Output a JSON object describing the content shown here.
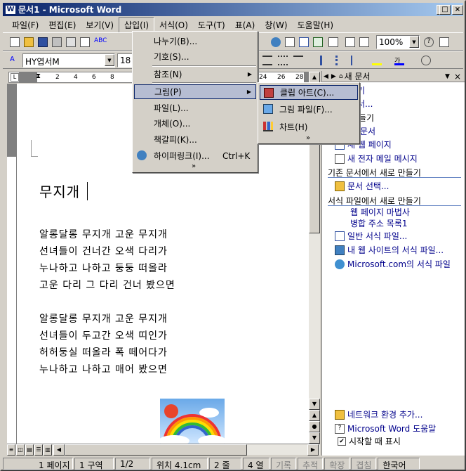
{
  "window": {
    "title": "문서1 - Microsoft Word",
    "icon": "word-doc-icon"
  },
  "menubar": [
    "파일(F)",
    "편집(E)",
    "보기(V)",
    "삽입(I)",
    "서식(O)",
    "도구(T)",
    "표(A)",
    "창(W)",
    "도움말(H)"
  ],
  "formatting": {
    "font": "HY엽서M",
    "size": "18",
    "zoom": "100%"
  },
  "ruler": [
    "2",
    "4",
    "6",
    "8",
    "24",
    "26",
    "28"
  ],
  "insert_menu": {
    "items": [
      {
        "label": "나누기(B)...",
        "icon": ""
      },
      {
        "label": "기호(S)...",
        "icon": ""
      },
      {
        "label": "참조(N)",
        "icon": "",
        "submenu": true
      },
      {
        "label": "그림(P)",
        "icon": "",
        "submenu": true,
        "highlighted": true
      },
      {
        "label": "파일(L)...",
        "icon": ""
      },
      {
        "label": "개체(O)...",
        "icon": ""
      },
      {
        "label": "책갈피(K)...",
        "icon": ""
      },
      {
        "label": "하이퍼링크(I)...",
        "shortcut": "Ctrl+K",
        "icon": "hyperlink-icon"
      }
    ],
    "more": "»"
  },
  "picture_submenu": {
    "items": [
      {
        "label": "클립 아트(C)...",
        "icon": "clip-art-icon",
        "highlighted": true
      },
      {
        "label": "그림 파일(F)...",
        "icon": "picture-file-icon"
      },
      {
        "label": "차트(H)",
        "icon": "chart-icon"
      }
    ],
    "more": "»"
  },
  "document": {
    "title": "무지개",
    "stanza1": [
      "알롱달롱 무지개 고운 무지개",
      "선녀들이 건너간 오색 다리가",
      "누나하고 나하고 둥둥 떠올라",
      "고운 다리 그 다리 건너 봤으면"
    ],
    "stanza2": [
      "알롱달롱 무지개 고운 무지개",
      "선녀들이 두고간 오색 띠인가",
      "허허둥실 떠올라 폭 떼어다가",
      "누나하고 나하고 매어 봤으면"
    ]
  },
  "taskpane": {
    "title": "새 문서",
    "partial": [
      "기",
      "서...",
      "들기",
      "문서"
    ],
    "new_items": [
      "새 웹 페이지",
      "새 전자 메일 메시지"
    ],
    "from_existing_header": "기존 문서에서 새로 만들기",
    "from_existing": [
      "문서 선택..."
    ],
    "from_template_header": "서식 파일에서 새로 만들기",
    "templates": [
      "웹 페이지 마법사",
      "병합 주소 목록1",
      "일반 서식 파일...",
      "내 웹 사이트의 서식 파일...",
      "Microsoft.com의 서식 파일"
    ],
    "bottom": [
      "네트워크 환경 추가...",
      "Microsoft Word 도움말"
    ],
    "startup_checkbox": "시작할 때 표시"
  },
  "status": {
    "page": "1 페이지",
    "section": "1 구역",
    "pages": "1/2",
    "position": "위치 4.1cm",
    "line": "2 줄",
    "col": "4 열",
    "rec": "기록",
    "trk": "추적",
    "ext": "확장",
    "ovr": "겹침",
    "lang": "한국어"
  }
}
